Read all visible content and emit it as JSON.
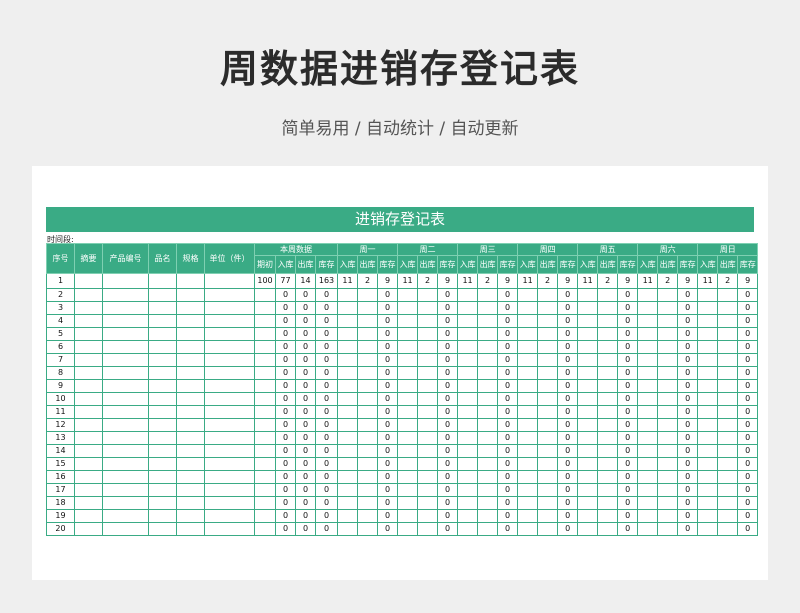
{
  "header": {
    "title": "周数据进销存登记表",
    "subtitle": "简单易用 / 自动统计 / 自动更新"
  },
  "sheet": {
    "banner": "进销存登记表",
    "period_label": "时间段:",
    "fixed_columns": [
      "序号",
      "摘要",
      "产品编号",
      "品名",
      "规格",
      "单位（件）"
    ],
    "week_group": {
      "label": "本周数据",
      "sub": [
        "期初",
        "入库",
        "出库",
        "库存"
      ]
    },
    "day_groups": [
      "周一",
      "周二",
      "周三",
      "周四",
      "周五",
      "周六",
      "周日"
    ],
    "day_sub": [
      "入库",
      "出库",
      "库存"
    ],
    "rows": [
      {
        "no": "1",
        "week": [
          "100",
          "77",
          "14",
          "163"
        ],
        "days": [
          [
            "11",
            "2",
            "9"
          ],
          [
            "11",
            "2",
            "9"
          ],
          [
            "11",
            "2",
            "9"
          ],
          [
            "11",
            "2",
            "9"
          ],
          [
            "11",
            "2",
            "9"
          ],
          [
            "11",
            "2",
            "9"
          ],
          [
            "11",
            "2",
            "9"
          ]
        ]
      },
      {
        "no": "2",
        "week": [
          "",
          "0",
          "0",
          "0"
        ],
        "days": [
          [
            "",
            "",
            "0"
          ],
          [
            "",
            "",
            "0"
          ],
          [
            "",
            "",
            "0"
          ],
          [
            "",
            "",
            "0"
          ],
          [
            "",
            "",
            "0"
          ],
          [
            "",
            "",
            "0"
          ],
          [
            "",
            "",
            "0"
          ]
        ]
      },
      {
        "no": "3",
        "week": [
          "",
          "0",
          "0",
          "0"
        ],
        "days": [
          [
            "",
            "",
            "0"
          ],
          [
            "",
            "",
            "0"
          ],
          [
            "",
            "",
            "0"
          ],
          [
            "",
            "",
            "0"
          ],
          [
            "",
            "",
            "0"
          ],
          [
            "",
            "",
            "0"
          ],
          [
            "",
            "",
            "0"
          ]
        ]
      },
      {
        "no": "4",
        "week": [
          "",
          "0",
          "0",
          "0"
        ],
        "days": [
          [
            "",
            "",
            "0"
          ],
          [
            "",
            "",
            "0"
          ],
          [
            "",
            "",
            "0"
          ],
          [
            "",
            "",
            "0"
          ],
          [
            "",
            "",
            "0"
          ],
          [
            "",
            "",
            "0"
          ],
          [
            "",
            "",
            "0"
          ]
        ]
      },
      {
        "no": "5",
        "week": [
          "",
          "0",
          "0",
          "0"
        ],
        "days": [
          [
            "",
            "",
            "0"
          ],
          [
            "",
            "",
            "0"
          ],
          [
            "",
            "",
            "0"
          ],
          [
            "",
            "",
            "0"
          ],
          [
            "",
            "",
            "0"
          ],
          [
            "",
            "",
            "0"
          ],
          [
            "",
            "",
            "0"
          ]
        ]
      },
      {
        "no": "6",
        "week": [
          "",
          "0",
          "0",
          "0"
        ],
        "days": [
          [
            "",
            "",
            "0"
          ],
          [
            "",
            "",
            "0"
          ],
          [
            "",
            "",
            "0"
          ],
          [
            "",
            "",
            "0"
          ],
          [
            "",
            "",
            "0"
          ],
          [
            "",
            "",
            "0"
          ],
          [
            "",
            "",
            "0"
          ]
        ]
      },
      {
        "no": "7",
        "week": [
          "",
          "0",
          "0",
          "0"
        ],
        "days": [
          [
            "",
            "",
            "0"
          ],
          [
            "",
            "",
            "0"
          ],
          [
            "",
            "",
            "0"
          ],
          [
            "",
            "",
            "0"
          ],
          [
            "",
            "",
            "0"
          ],
          [
            "",
            "",
            "0"
          ],
          [
            "",
            "",
            "0"
          ]
        ]
      },
      {
        "no": "8",
        "week": [
          "",
          "0",
          "0",
          "0"
        ],
        "days": [
          [
            "",
            "",
            "0"
          ],
          [
            "",
            "",
            "0"
          ],
          [
            "",
            "",
            "0"
          ],
          [
            "",
            "",
            "0"
          ],
          [
            "",
            "",
            "0"
          ],
          [
            "",
            "",
            "0"
          ],
          [
            "",
            "",
            "0"
          ]
        ]
      },
      {
        "no": "9",
        "week": [
          "",
          "0",
          "0",
          "0"
        ],
        "days": [
          [
            "",
            "",
            "0"
          ],
          [
            "",
            "",
            "0"
          ],
          [
            "",
            "",
            "0"
          ],
          [
            "",
            "",
            "0"
          ],
          [
            "",
            "",
            "0"
          ],
          [
            "",
            "",
            "0"
          ],
          [
            "",
            "",
            "0"
          ]
        ]
      },
      {
        "no": "10",
        "week": [
          "",
          "0",
          "0",
          "0"
        ],
        "days": [
          [
            "",
            "",
            "0"
          ],
          [
            "",
            "",
            "0"
          ],
          [
            "",
            "",
            "0"
          ],
          [
            "",
            "",
            "0"
          ],
          [
            "",
            "",
            "0"
          ],
          [
            "",
            "",
            "0"
          ],
          [
            "",
            "",
            "0"
          ]
        ]
      },
      {
        "no": "11",
        "week": [
          "",
          "0",
          "0",
          "0"
        ],
        "days": [
          [
            "",
            "",
            "0"
          ],
          [
            "",
            "",
            "0"
          ],
          [
            "",
            "",
            "0"
          ],
          [
            "",
            "",
            "0"
          ],
          [
            "",
            "",
            "0"
          ],
          [
            "",
            "",
            "0"
          ],
          [
            "",
            "",
            "0"
          ]
        ]
      },
      {
        "no": "12",
        "week": [
          "",
          "0",
          "0",
          "0"
        ],
        "days": [
          [
            "",
            "",
            "0"
          ],
          [
            "",
            "",
            "0"
          ],
          [
            "",
            "",
            "0"
          ],
          [
            "",
            "",
            "0"
          ],
          [
            "",
            "",
            "0"
          ],
          [
            "",
            "",
            "0"
          ],
          [
            "",
            "",
            "0"
          ]
        ]
      },
      {
        "no": "13",
        "week": [
          "",
          "0",
          "0",
          "0"
        ],
        "days": [
          [
            "",
            "",
            "0"
          ],
          [
            "",
            "",
            "0"
          ],
          [
            "",
            "",
            "0"
          ],
          [
            "",
            "",
            "0"
          ],
          [
            "",
            "",
            "0"
          ],
          [
            "",
            "",
            "0"
          ],
          [
            "",
            "",
            "0"
          ]
        ]
      },
      {
        "no": "14",
        "week": [
          "",
          "0",
          "0",
          "0"
        ],
        "days": [
          [
            "",
            "",
            "0"
          ],
          [
            "",
            "",
            "0"
          ],
          [
            "",
            "",
            "0"
          ],
          [
            "",
            "",
            "0"
          ],
          [
            "",
            "",
            "0"
          ],
          [
            "",
            "",
            "0"
          ],
          [
            "",
            "",
            "0"
          ]
        ]
      },
      {
        "no": "15",
        "week": [
          "",
          "0",
          "0",
          "0"
        ],
        "days": [
          [
            "",
            "",
            "0"
          ],
          [
            "",
            "",
            "0"
          ],
          [
            "",
            "",
            "0"
          ],
          [
            "",
            "",
            "0"
          ],
          [
            "",
            "",
            "0"
          ],
          [
            "",
            "",
            "0"
          ],
          [
            "",
            "",
            "0"
          ]
        ]
      },
      {
        "no": "16",
        "week": [
          "",
          "0",
          "0",
          "0"
        ],
        "days": [
          [
            "",
            "",
            "0"
          ],
          [
            "",
            "",
            "0"
          ],
          [
            "",
            "",
            "0"
          ],
          [
            "",
            "",
            "0"
          ],
          [
            "",
            "",
            "0"
          ],
          [
            "",
            "",
            "0"
          ],
          [
            "",
            "",
            "0"
          ]
        ]
      },
      {
        "no": "17",
        "week": [
          "",
          "0",
          "0",
          "0"
        ],
        "days": [
          [
            "",
            "",
            "0"
          ],
          [
            "",
            "",
            "0"
          ],
          [
            "",
            "",
            "0"
          ],
          [
            "",
            "",
            "0"
          ],
          [
            "",
            "",
            "0"
          ],
          [
            "",
            "",
            "0"
          ],
          [
            "",
            "",
            "0"
          ]
        ]
      },
      {
        "no": "18",
        "week": [
          "",
          "0",
          "0",
          "0"
        ],
        "days": [
          [
            "",
            "",
            "0"
          ],
          [
            "",
            "",
            "0"
          ],
          [
            "",
            "",
            "0"
          ],
          [
            "",
            "",
            "0"
          ],
          [
            "",
            "",
            "0"
          ],
          [
            "",
            "",
            "0"
          ],
          [
            "",
            "",
            "0"
          ]
        ]
      },
      {
        "no": "19",
        "week": [
          "",
          "0",
          "0",
          "0"
        ],
        "days": [
          [
            "",
            "",
            "0"
          ],
          [
            "",
            "",
            "0"
          ],
          [
            "",
            "",
            "0"
          ],
          [
            "",
            "",
            "0"
          ],
          [
            "",
            "",
            "0"
          ],
          [
            "",
            "",
            "0"
          ],
          [
            "",
            "",
            "0"
          ]
        ]
      },
      {
        "no": "20",
        "week": [
          "",
          "0",
          "0",
          "0"
        ],
        "days": [
          [
            "",
            "",
            "0"
          ],
          [
            "",
            "",
            "0"
          ],
          [
            "",
            "",
            "0"
          ],
          [
            "",
            "",
            "0"
          ],
          [
            "",
            "",
            "0"
          ],
          [
            "",
            "",
            "0"
          ],
          [
            "",
            "",
            "0"
          ]
        ]
      }
    ]
  },
  "colors": {
    "accent": "#3aab85",
    "page_bg": "#efefef"
  }
}
